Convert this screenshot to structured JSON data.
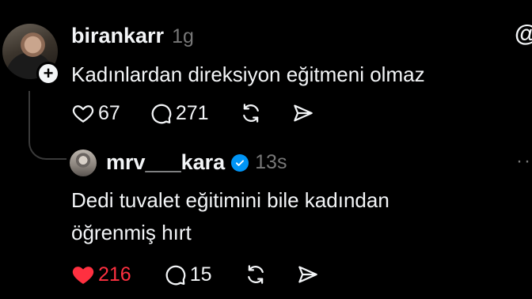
{
  "post": {
    "username": "birankarr",
    "time": "1g",
    "text": "Kadınlardan direksiyon eğitmeni olmaz",
    "likes": "67",
    "comments": "271"
  },
  "reply": {
    "username": "mrv___kara",
    "time": "13s",
    "text_line1": "Dedi tuvalet eğitimini bile kadından",
    "text_line2": "öğrenmiş hırt",
    "likes": "216",
    "comments": "15"
  },
  "colors": {
    "background": "#000000",
    "text": "#f3f5f7",
    "muted": "#777777",
    "like_active": "#ff3040",
    "verified": "#0095f6"
  },
  "icons": [
    "threads-logo-icon",
    "heart-icon",
    "comment-icon",
    "repost-icon",
    "share-icon",
    "verified-badge-icon",
    "more-icon",
    "plus-icon"
  ]
}
